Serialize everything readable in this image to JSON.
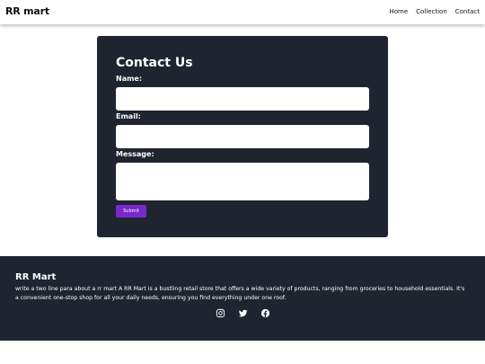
{
  "navbar": {
    "brand": "RR mart",
    "links": [
      "Home",
      "Collection",
      "Contact"
    ]
  },
  "contact_form": {
    "title": "Contact Us",
    "name_label": "Name:",
    "name_value": "",
    "email_label": "Email:",
    "email_value": "",
    "message_label": "Message:",
    "message_value": "",
    "submit_label": "Submit"
  },
  "footer": {
    "title": "RR Mart",
    "description": "write a two line para about a rr mart A RR Mart is a bustling retail store that offers a wide variety of products, ranging from groceries to household essentials. It's a convenient one-stop shop for all your daily needs, ensuring you find everything under one roof.",
    "social_icons": [
      "instagram-icon",
      "twitter-icon",
      "facebook-icon"
    ]
  },
  "colors": {
    "card_background": "#1f2430",
    "footer_background": "#1f2430",
    "submit_button": "#7a28cb",
    "page_background": "#ffffff"
  }
}
